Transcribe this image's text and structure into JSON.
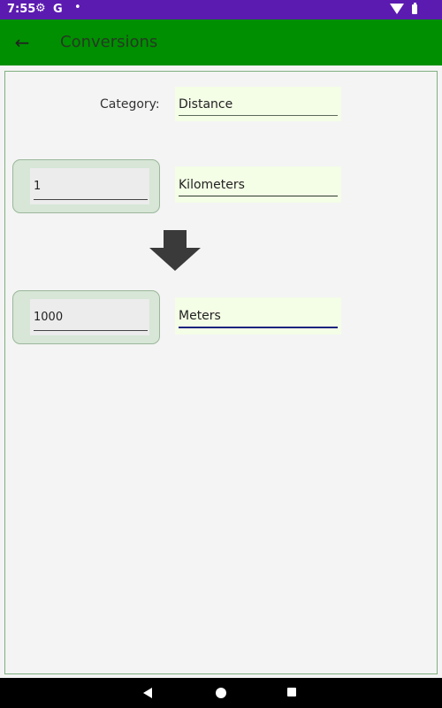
{
  "status_bar": {
    "time": "7:55",
    "gear_icon": "⚙",
    "google_letter": "G",
    "notification_dot": "•",
    "color": "#5b1bb0"
  },
  "app_bar": {
    "back_icon": "←",
    "title": "Conversions",
    "color": "#008f00"
  },
  "form": {
    "category_label": "Category:",
    "category_value": "Distance",
    "from_value": "1",
    "from_unit": "Kilometers",
    "to_value": "1000",
    "to_unit": "Meters"
  },
  "icons": {
    "arrow": "down-arrow-icon"
  }
}
